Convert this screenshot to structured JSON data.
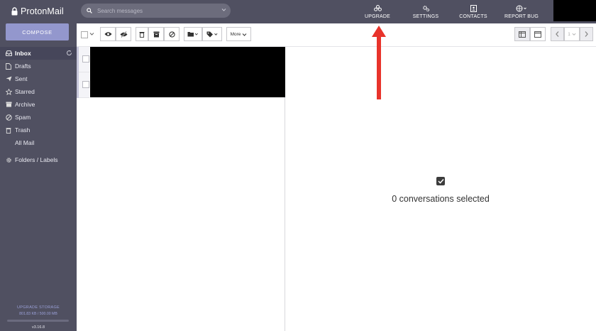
{
  "app": {
    "name": "ProtonMail"
  },
  "sidebar": {
    "compose_label": "COMPOSE",
    "items": [
      {
        "label": "Inbox",
        "icon": "inbox-icon",
        "active": true
      },
      {
        "label": "Drafts",
        "icon": "drafts-icon"
      },
      {
        "label": "Sent",
        "icon": "sent-icon"
      },
      {
        "label": "Starred",
        "icon": "star-icon"
      },
      {
        "label": "Archive",
        "icon": "archive-icon"
      },
      {
        "label": "Spam",
        "icon": "spam-icon"
      },
      {
        "label": "Trash",
        "icon": "trash-icon"
      },
      {
        "label": "All Mail",
        "icon": ""
      },
      {
        "label": "Folders / Labels",
        "icon": "gear-icon"
      }
    ],
    "storage_title": "UPGRADE STORAGE",
    "storage_value": "801.83 KB / 500.00 MB",
    "version": "v3.16.8"
  },
  "header": {
    "search_placeholder": "Search messages",
    "nav": [
      {
        "label": "UPGRADE",
        "icon": "upgrade-icon"
      },
      {
        "label": "SETTINGS",
        "icon": "settings-icon"
      },
      {
        "label": "CONTACTS",
        "icon": "contacts-icon"
      },
      {
        "label": "REPORT BUG",
        "icon": "globe-icon"
      }
    ]
  },
  "toolbar": {
    "more_label": "More",
    "page_number": "1"
  },
  "reading_pane": {
    "empty_message": "0 conversations selected"
  },
  "colors": {
    "sidebar_bg": "#505061",
    "compose_bg": "#9397cd",
    "arrow": "#e8332b"
  }
}
